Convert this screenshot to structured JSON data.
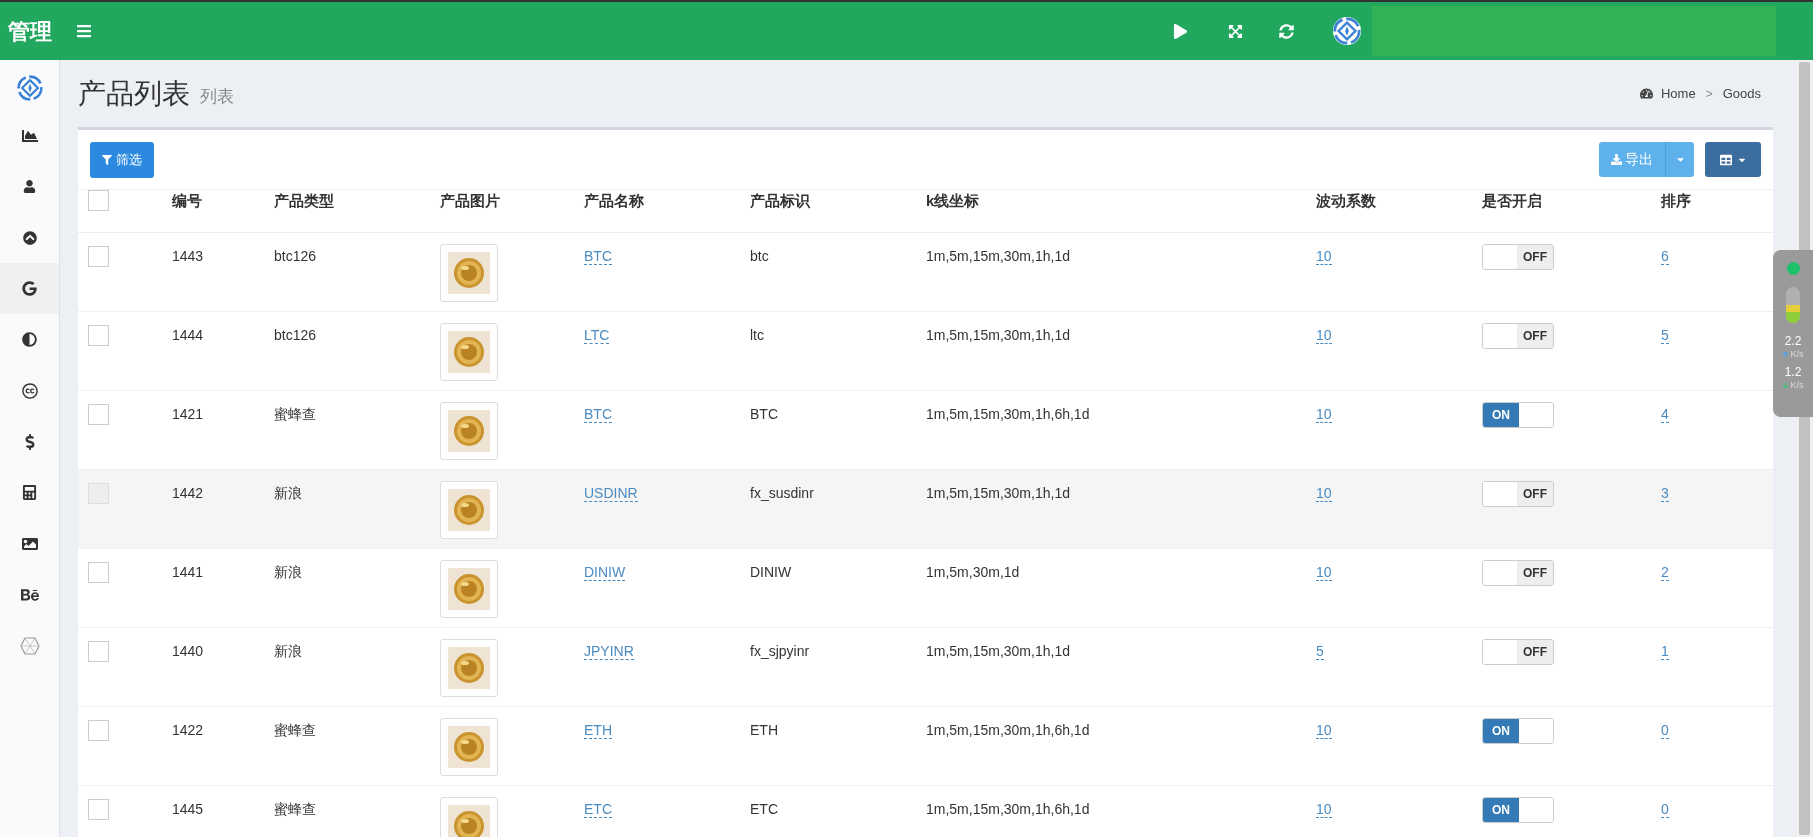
{
  "topbar": {
    "brand": "管理"
  },
  "sidebar": {
    "items": [
      {
        "selected": false
      },
      {
        "selected": false
      },
      {
        "selected": false
      },
      {
        "selected": true
      },
      {
        "selected": false
      },
      {
        "selected": false
      },
      {
        "selected": false
      },
      {
        "selected": false
      },
      {
        "selected": false
      },
      {
        "selected": false
      },
      {
        "selected": false
      }
    ]
  },
  "page_header": {
    "title": "产品列表",
    "subtitle": "列表",
    "breadcrumb": [
      "Home",
      "Goods"
    ],
    "separator": ">"
  },
  "toolbar": {
    "filter_button": "筛选",
    "export_button": "导出"
  },
  "table": {
    "select_all_checked": false,
    "columns": [
      "编号",
      "产品类型",
      "产品图片",
      "产品名称",
      "产品标识",
      "k线坐标",
      "波动系数",
      "是否开启",
      "排序"
    ],
    "rows": [
      {
        "id": "1443",
        "type": "btc126",
        "name": "BTC",
        "symbol": "btc",
        "kline": "1m,5m,15m,30m,1h,1d",
        "factor": "10",
        "on": false,
        "switch_label": "OFF",
        "sort": "6",
        "highlighted": false
      },
      {
        "id": "1444",
        "type": "btc126",
        "name": "LTC",
        "symbol": "ltc",
        "kline": "1m,5m,15m,30m,1h,1d",
        "factor": "10",
        "on": false,
        "switch_label": "OFF",
        "sort": "5",
        "highlighted": false
      },
      {
        "id": "1421",
        "type": "蜜蜂查",
        "name": "BTC",
        "symbol": "BTC",
        "kline": "1m,5m,15m,30m,1h,6h,1d",
        "factor": "10",
        "on": true,
        "switch_label": "ON",
        "sort": "4",
        "highlighted": false
      },
      {
        "id": "1442",
        "type": "新浪",
        "name": "USDINR",
        "symbol": "fx_susdinr",
        "kline": "1m,5m,15m,30m,1h,1d",
        "factor": "10",
        "on": false,
        "switch_label": "OFF",
        "sort": "3",
        "highlighted": true
      },
      {
        "id": "1441",
        "type": "新浪",
        "name": "DINIW",
        "symbol": "DINIW",
        "kline": "1m,5m,30m,1d",
        "factor": "10",
        "on": false,
        "switch_label": "OFF",
        "sort": "2",
        "highlighted": false
      },
      {
        "id": "1440",
        "type": "新浪",
        "name": "JPYINR",
        "symbol": "fx_sjpyinr",
        "kline": "1m,5m,15m,30m,1h,1d",
        "factor": "5",
        "on": false,
        "switch_label": "OFF",
        "sort": "1",
        "highlighted": false
      },
      {
        "id": "1422",
        "type": "蜜蜂查",
        "name": "ETH",
        "symbol": "ETH",
        "kline": "1m,5m,15m,30m,1h,6h,1d",
        "factor": "10",
        "on": true,
        "switch_label": "ON",
        "sort": "0",
        "highlighted": false
      },
      {
        "id": "1445",
        "type": "蜜蜂查",
        "name": "ETC",
        "symbol": "ETC",
        "kline": "1m,5m,15m,30m,1h,6h,1d",
        "factor": "10",
        "on": true,
        "switch_label": "ON",
        "sort": "0",
        "highlighted": false
      }
    ]
  },
  "speed_widget": {
    "upload": "2.2",
    "upload_unit": "K/s",
    "download": "1.2",
    "download_unit": "K/s"
  }
}
